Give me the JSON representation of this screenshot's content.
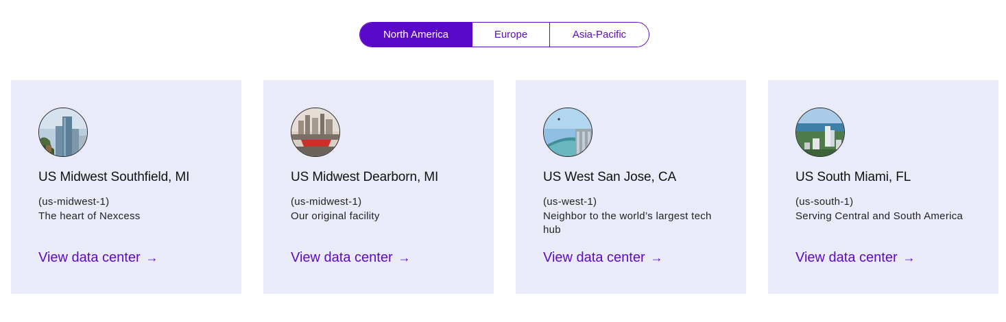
{
  "region_tabs": {
    "items": [
      {
        "label": "North America",
        "active": true
      },
      {
        "label": "Europe",
        "active": false
      },
      {
        "label": "Asia-Pacific",
        "active": false
      }
    ]
  },
  "cards": [
    {
      "title": "US Midwest Southfield, MI",
      "region": "(us-midwest-1)",
      "description": "The heart of Nexcess",
      "link": "View data center",
      "arrow": "→",
      "image": "southfield-skyline-photo"
    },
    {
      "title": "US Midwest Dearborn, MI",
      "region": "(us-midwest-1)",
      "description": "Our original facility",
      "link": "View data center",
      "arrow": "→",
      "image": "dearborn-skyline-photo"
    },
    {
      "title": "US West San Jose, CA",
      "region": "(us-west-1)",
      "description": "Neighbor to the world’s largest tech hub",
      "link": "View data center",
      "arrow": "→",
      "image": "san-jose-building-photo"
    },
    {
      "title": "US South Miami, FL",
      "region": "(us-south-1)",
      "description": "Serving Central and South America",
      "link": "View data center",
      "arrow": "→",
      "image": "miami-skyline-photo"
    }
  ],
  "colors": {
    "accent": "#5b09c8",
    "card_background": "#eaebf9",
    "text": "#111111"
  }
}
